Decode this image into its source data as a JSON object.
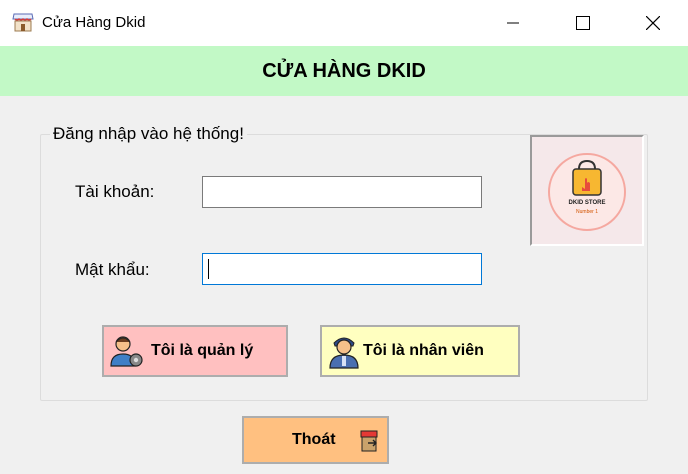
{
  "window": {
    "title": "Cửa Hàng Dkid"
  },
  "header": {
    "title": "CỬA HÀNG DKID"
  },
  "login": {
    "group_title": "Đăng nhập vào hệ thống!",
    "username_label": "Tài khoản:",
    "username_value": "",
    "password_label": "Mật khẩu:",
    "password_value": ""
  },
  "logo": {
    "text": "DKID STORE",
    "subtext": "Number 1"
  },
  "buttons": {
    "manager": "Tôi là quản lý",
    "staff": "Tôi là nhân viên",
    "exit": "Thoát"
  },
  "colors": {
    "header_bg": "#c2f9c6",
    "manager_btn": "#ffc0c0",
    "staff_btn": "#ffffc0",
    "exit_btn": "#ffc080"
  },
  "icons": {
    "app": "store-icon",
    "manager": "manager-icon",
    "staff": "staff-icon",
    "exit": "exit-door-icon"
  }
}
